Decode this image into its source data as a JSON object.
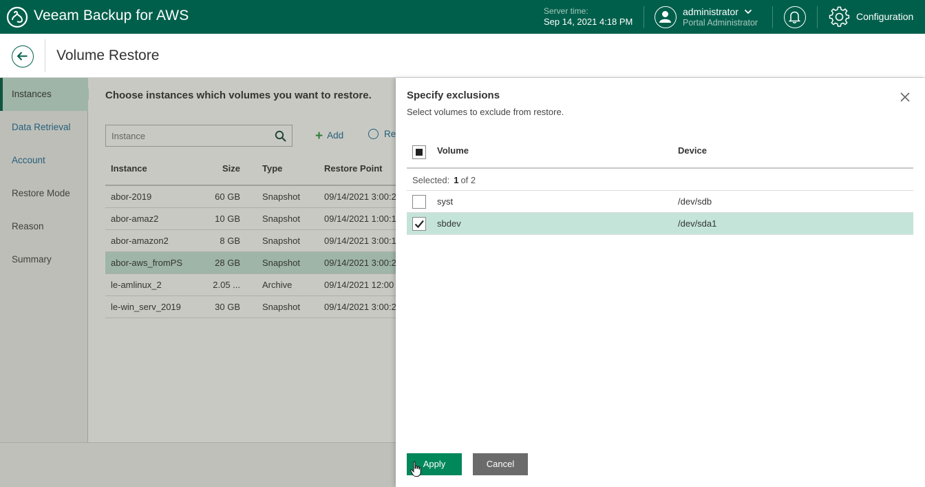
{
  "header": {
    "app_title": "Veeam Backup for AWS",
    "server_time_label": "Server time:",
    "server_time_value": "Sep 14, 2021 4:18 PM",
    "user_name": "administrator",
    "user_role": "Portal Administrator",
    "configuration_label": "Configuration"
  },
  "titlebar": {
    "page_title": "Volume Restore"
  },
  "wizard_nav": {
    "items": [
      {
        "label": "Instances",
        "state": "active"
      },
      {
        "label": "Data Retrieval",
        "state": "done"
      },
      {
        "label": "Account",
        "state": "done"
      },
      {
        "label": "Restore Mode",
        "state": "pending"
      },
      {
        "label": "Reason",
        "state": "pending"
      },
      {
        "label": "Summary",
        "state": "pending"
      }
    ]
  },
  "main": {
    "heading": "Choose instances which volumes you want to restore.",
    "search_placeholder": "Instance",
    "add_label": "Add",
    "re_label": "Re",
    "columns": {
      "name": "Instance",
      "size": "Size",
      "type": "Type",
      "restore_point": "Restore Point"
    },
    "rows": [
      {
        "name": "abor-2019",
        "size": "60 GB",
        "type": "Snapshot",
        "restore_point": "09/14/2021 3:00:2",
        "selected": false
      },
      {
        "name": "abor-amaz2",
        "size": "10 GB",
        "type": "Snapshot",
        "restore_point": "09/14/2021 1:00:1",
        "selected": false
      },
      {
        "name": "abor-amazon2",
        "size": "8 GB",
        "type": "Snapshot",
        "restore_point": "09/14/2021 3:00:1",
        "selected": false
      },
      {
        "name": "abor-aws_fromPS",
        "size": "28 GB",
        "type": "Snapshot",
        "restore_point": "09/14/2021 3:00:2",
        "selected": true
      },
      {
        "name": "le-amlinux_2",
        "size": "2.05 ...",
        "type": "Archive",
        "restore_point": "09/14/2021 12:00",
        "selected": false
      },
      {
        "name": "le-win_serv_2019",
        "size": "30 GB",
        "type": "Snapshot",
        "restore_point": "09/14/2021 3:00:2",
        "selected": false
      }
    ]
  },
  "panel": {
    "title": "Specify exclusions",
    "subtitle": "Select volumes to exclude from restore.",
    "columns": {
      "volume": "Volume",
      "device": "Device"
    },
    "selected_label": "Selected:",
    "selected_count": "1",
    "selected_of": "of 2",
    "volumes": [
      {
        "name": "syst",
        "device": "/dev/sdb",
        "checked": false
      },
      {
        "name": "sbdev",
        "device": "/dev/sda1",
        "checked": true
      }
    ],
    "apply_label": "Apply",
    "cancel_label": "Cancel"
  },
  "colors": {
    "header_bg": "#005f4b",
    "selected_row": "#c4e4d9",
    "apply_button": "#00875a",
    "cancel_button": "#6b6b6b",
    "link": "#1a6e9a"
  }
}
